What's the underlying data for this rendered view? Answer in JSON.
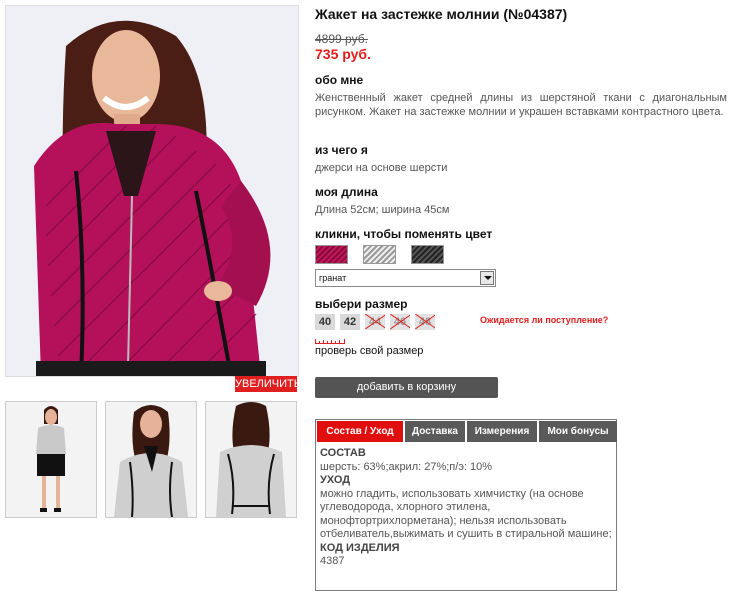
{
  "gallery": {
    "enlarge_label": "УВЕЛИЧИТЬ"
  },
  "product": {
    "title": "Жакет на застежке молнии (№04387)",
    "old_price": "4899 руб.",
    "new_price": "735 руб.",
    "about_heading": "обо мне",
    "about_text": "Женственный жакет средней длины из шерстяной ткани с диагональным рисунком. Жакет на застежке молнии и украшен вставками контрастного цвета.",
    "material_heading": "из чего я",
    "material_text": "джерси на основе шерсти",
    "length_heading": "моя длина",
    "length_text": "Длина 52см; ширина 45см",
    "color_heading": "кликни, чтобы поменять цвет",
    "color_select_value": "гранат",
    "size_heading": "выбери размер",
    "sizes": [
      {
        "label": "40",
        "available": true
      },
      {
        "label": "42",
        "available": true
      },
      {
        "label": "44",
        "available": false
      },
      {
        "label": "46",
        "available": false
      },
      {
        "label": "48",
        "available": false
      }
    ],
    "awaiting_link": "Ожидается ли поступление?",
    "check_size_link": "проверь свой размер",
    "add_to_cart": "добавить в корзину"
  },
  "tabs": {
    "items": [
      "Состав / Уход",
      "Доставка",
      "Измерения",
      "Мои бонусы"
    ],
    "active_index": 0,
    "content": {
      "composition_heading": "СОСТАВ",
      "composition_text": "шерсть: 63%;акрил: 27%;п/э: 10%",
      "care_heading": "УХОД",
      "care_text": "можно гладить, использовать химчистку (на основе углеводорода, хлорного этилена, монофтортрихлорметана); нельзя использовать отбеливатель,выжимать и сушить в стиральной машине;",
      "code_heading": "КОД ИЗДЕЛИЯ",
      "code_value": "4387"
    }
  },
  "colors": {
    "price_red": "#e51d1d",
    "tab_active": "#e10e0e",
    "tab_inactive": "#5a5a5a",
    "cart_button": "#545454",
    "jacket_main": "#b5115a"
  }
}
